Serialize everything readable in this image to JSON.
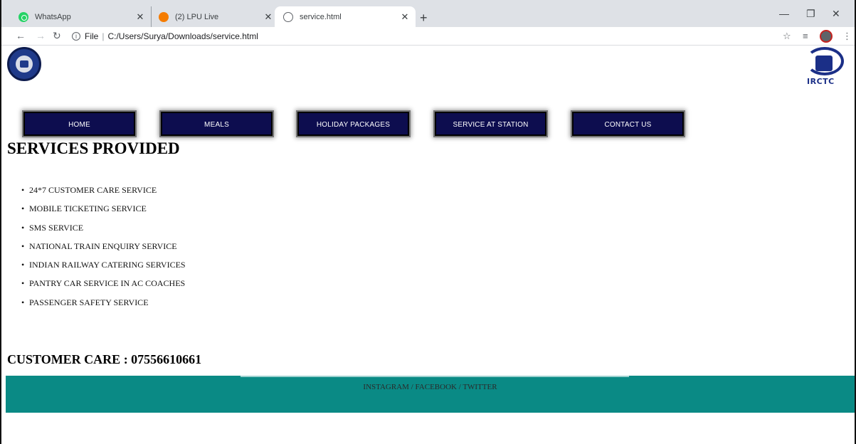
{
  "browser": {
    "tabs": [
      {
        "label": "WhatsApp",
        "icon": "whatsapp-icon"
      },
      {
        "label": "(2) LPU Live",
        "icon": "lpu-icon"
      },
      {
        "label": "service.html",
        "icon": "globe-icon"
      }
    ],
    "address": {
      "scheme_label": "File",
      "path": "C:/Users/Surya/Downloads/service.html"
    }
  },
  "nav": {
    "items": [
      "HOME",
      "MEALS",
      "HOLIDAY PACKAGES",
      "SERVICE AT STATION",
      "CONTACT US"
    ]
  },
  "logos": {
    "right_word": "IRCTC"
  },
  "main": {
    "heading": "SERVICES PROVIDED",
    "services": [
      "24*7 CUSTOMER CARE SERVICE",
      "MOBILE TICKETING SERVICE",
      "SMS SERVICE",
      "NATIONAL TRAIN ENQUIRY SERVICE",
      "INDIAN RAILWAY CATERING SERVICES",
      "PANTRY CAR SERVICE IN AC COACHES",
      "PASSENGER SAFETY SERVICE"
    ],
    "customer_care": "CUSTOMER CARE : 07556610661"
  },
  "footer": {
    "links": "INSTAGRAM / FACEBOOK / TWITTER"
  },
  "colors": {
    "nav_bg": "#0d0d4f",
    "footer_bg": "#0a8a85",
    "tab_strip": "#dee1e6"
  }
}
